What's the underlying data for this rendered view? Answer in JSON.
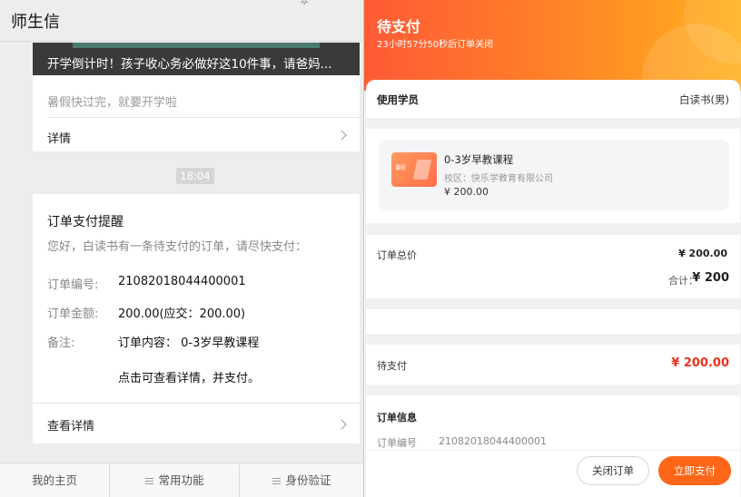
{
  "chat": {
    "title": "师生信",
    "article": {
      "headline": "开学倒计时！孩子收心务必做好这10件事，请爸妈...",
      "summary": "暑假快过完，就要开学啦",
      "detail_label": "详情"
    },
    "timestamp": "18:04",
    "order_notice": {
      "title": "订单支付提醒",
      "intro": "您好，白读书有一条待支付的订单，请尽快支付：",
      "order_no_label": "订单编号:",
      "order_no": "21082018044400001",
      "amount_label": "订单金额:",
      "amount": "200.00(应交：200.00)",
      "remark_label": "备注:",
      "remark": "订单内容： 0-3岁早教课程",
      "hint": "点击可查看详情，并支付。",
      "view_detail_label": "查看详情"
    },
    "bottom_menu": [
      "我的主页",
      "常用功能",
      "身份验证"
    ]
  },
  "payment": {
    "status_title": "待支付",
    "countdown": "23小时57分50秒后订单关闭",
    "student_label": "使用学员",
    "student_name": "白读书(男)",
    "course": {
      "thumb_text": "课程",
      "name": "0-3岁早教课程",
      "campus": "校区：快乐学教育有限公司",
      "price": "¥ 200.00"
    },
    "total_label": "订单总价",
    "total_value": "¥ 200.00",
    "sum_label": "合计：",
    "sum_value": "¥ 200",
    "pending_label": "待支付",
    "pending_value": "¥ 200.00",
    "info_title": "订单信息",
    "info_order_no_label": "订单编号",
    "info_order_no": "21082018044400001",
    "close_order_label": "关闭订单",
    "pay_now_label": "立即支付"
  },
  "colors": {
    "header_gradient_start": "#ff5a36",
    "header_gradient_end": "#ffb11c",
    "pay_button": "#ff6617",
    "pending_amount": "#f0321e"
  }
}
